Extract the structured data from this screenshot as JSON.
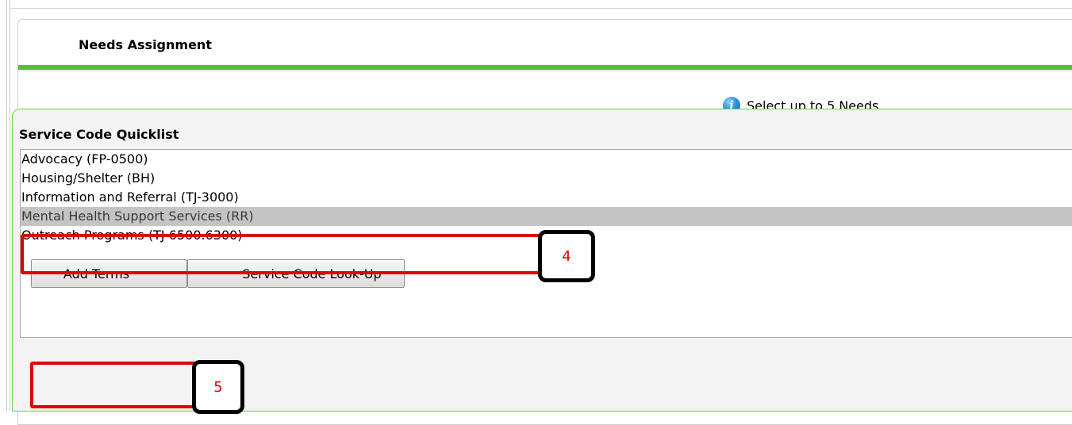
{
  "panel": {
    "title": "Needs Assignment"
  },
  "hint": {
    "text": "Select up to 5 Needs",
    "icon": "info-icon"
  },
  "quicklist": {
    "title": "Service Code Quicklist",
    "items": [
      {
        "label": "Advocacy (FP-0500)",
        "selected": false
      },
      {
        "label": "Housing/Shelter (BH)",
        "selected": false
      },
      {
        "label": "Information and Referral (TJ-3000)",
        "selected": false
      },
      {
        "label": "Mental Health Support Services (RR)",
        "selected": true
      },
      {
        "label": "Outreach Programs (TJ-6500.6300)",
        "selected": false
      }
    ]
  },
  "buttons": {
    "add_terms": "Add Terms",
    "lookup": "Service Code Look-Up"
  },
  "annotations": {
    "step4": "4",
    "step5": "5"
  },
  "colors": {
    "accent_green": "#52c233",
    "annotation_red": "#e00000",
    "selected_row": "#c4c4c4"
  }
}
